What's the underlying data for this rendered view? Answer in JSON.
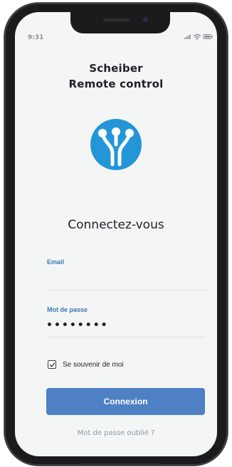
{
  "status_bar": {
    "time": "9:31",
    "icons": [
      "cellular-signal-icon",
      "wifi-icon",
      "battery-icon"
    ]
  },
  "app": {
    "title_line1": "Scheiber",
    "title_line2": "Remote control",
    "logo_icon": "scheiber-logo-icon",
    "brand_color": "#2496d8"
  },
  "login": {
    "heading": "Connectez-vous",
    "email_label": "Email",
    "email_value": "",
    "password_label": "Mot de passe",
    "password_value": "••••••••",
    "remember_label": "Se souvenir de moi",
    "remember_checked": true,
    "submit_label": "Connexion",
    "forgot_label": "Mot de passe oublié ?",
    "accent_color": "#4e80c3"
  }
}
